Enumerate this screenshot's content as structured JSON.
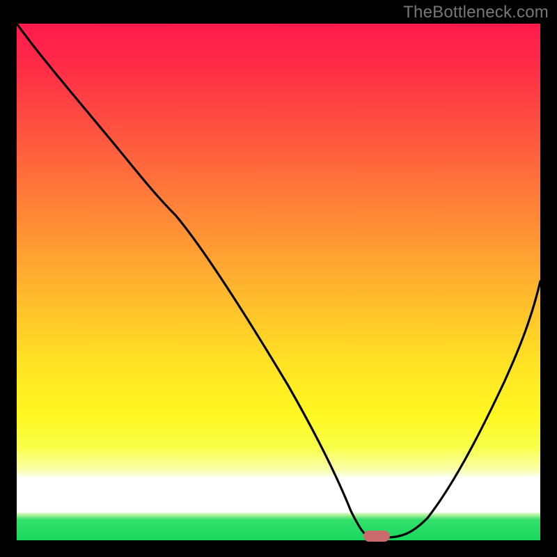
{
  "watermark": "TheBottleneck.com",
  "chart_data": {
    "type": "line",
    "title": "",
    "xlabel": "",
    "ylabel": "",
    "xlim": [
      0,
      100
    ],
    "ylim": [
      0,
      100
    ],
    "grid": false,
    "legend": false,
    "background_gradient": {
      "stops": [
        {
          "pos": 0.0,
          "color": "#ff1a4d"
        },
        {
          "pos": 0.38,
          "color": "#ff8a36"
        },
        {
          "pos": 0.66,
          "color": "#ffe324"
        },
        {
          "pos": 0.88,
          "color": "#ffffff"
        },
        {
          "pos": 0.96,
          "color": "#34e06a"
        },
        {
          "pos": 1.0,
          "color": "#18d85e"
        }
      ]
    },
    "series": [
      {
        "name": "bottleneck-curve",
        "color": "#000000",
        "x": [
          0,
          8,
          16,
          24,
          30,
          38,
          46,
          54,
          60,
          63,
          67,
          72,
          78,
          84,
          90,
          96,
          100
        ],
        "y": [
          100,
          90,
          80,
          70,
          64,
          52,
          40,
          28,
          16,
          6,
          2,
          1,
          4,
          14,
          28,
          44,
          58
        ]
      }
    ],
    "marker": {
      "name": "optimal-point",
      "x": 69,
      "y": 1,
      "color": "#c96a6c",
      "shape": "pill"
    }
  }
}
